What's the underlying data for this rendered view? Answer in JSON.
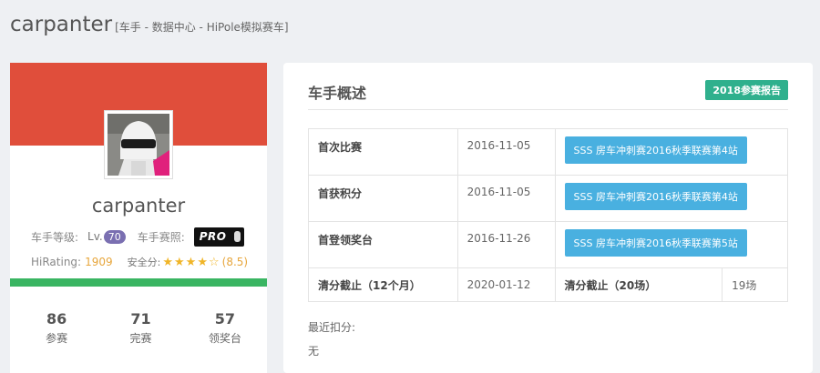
{
  "header": {
    "title": "carpanter",
    "subtitle": "[车手 - 数据中心 - HiPole模拟赛车]"
  },
  "profile": {
    "name": "carpanter",
    "level_label": "车手等级:",
    "level_prefix": "Lv.",
    "level_value": "70",
    "license_label": "车手赛照:",
    "license_value": "PRO",
    "hirating_label": "HiRating:",
    "hirating_value": "1909",
    "safety_label": "安全分:",
    "safety_stars_filled": 4,
    "safety_stars_total": 5,
    "safety_value": "(8.5)",
    "progress_fraction": 1.0,
    "colors": {
      "banner": "#e04e3b",
      "progress": "#3ab562",
      "level_badge": "#7a6fb1"
    },
    "stats": [
      {
        "value": "86",
        "label": "参赛"
      },
      {
        "value": "71",
        "label": "完赛"
      },
      {
        "value": "57",
        "label": "领奖台"
      }
    ]
  },
  "summary": {
    "title": "车手概述",
    "report_button": "2018参赛报告",
    "rows": [
      {
        "label": "首次比赛",
        "date": "2016-11-05",
        "race": "SSS 房车冲刺赛2016秋季联赛第4站"
      },
      {
        "label": "首获积分",
        "date": "2016-11-05",
        "race": "SSS 房车冲刺赛2016秋季联赛第4站"
      },
      {
        "label": "首登领奖台",
        "date": "2016-11-26",
        "race": "SSS 房车冲刺赛2016秋季联赛第5站"
      }
    ],
    "last_row": {
      "label": "清分截止（12个月）",
      "date": "2020-01-12",
      "count_label": "清分截止（20场）",
      "count_value": "19场"
    },
    "recent_label": "最近扣分:",
    "recent_value": "无",
    "colors": {
      "report_badge": "#2fb08d",
      "race_link": "#49b0e0"
    }
  }
}
